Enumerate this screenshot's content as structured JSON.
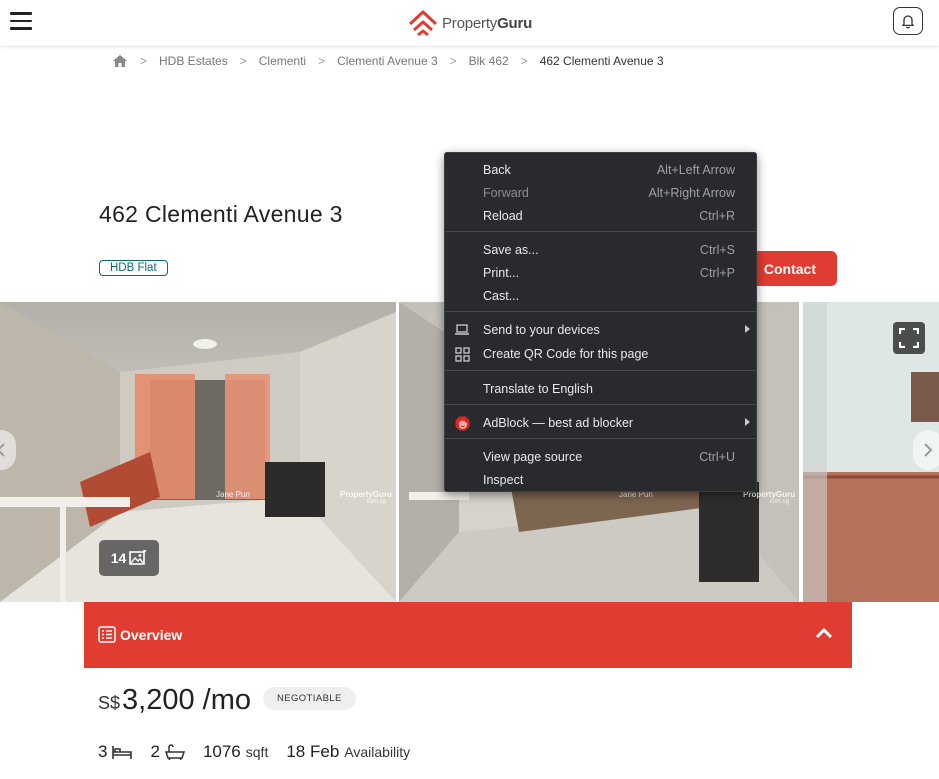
{
  "header": {
    "brand_light": "Property",
    "brand_bold": "Guru",
    "brand_color": "#e03c31"
  },
  "breadcrumb": {
    "items": [
      "HDB Estates",
      "Clementi",
      "Clementi Avenue 3",
      "Blk 462"
    ],
    "current": "462 Clementi Avenue 3",
    "separator": ">"
  },
  "listing": {
    "title": "462 Clementi Avenue 3",
    "type_badge": "HDB Flat",
    "contact_label": "Contact",
    "photo_count": "14",
    "watermark_name": "Jane Pun",
    "watermark_brand": "PropertyGuru",
    "watermark_domain": ".com.sg"
  },
  "overview": {
    "label": "Overview"
  },
  "price": {
    "currency": "S$",
    "amount": "3,200 /mo",
    "negotiable": "NEGOTIABLE"
  },
  "facts": {
    "bedrooms": "3",
    "bathrooms": "2",
    "area": "1076",
    "area_unit": "sqft",
    "availability_date": "18 Feb",
    "availability_label": "Availability"
  },
  "context_menu": {
    "back": {
      "label": "Back",
      "shortcut": "Alt+Left Arrow"
    },
    "forward": {
      "label": "Forward",
      "shortcut": "Alt+Right Arrow"
    },
    "reload": {
      "label": "Reload",
      "shortcut": "Ctrl+R"
    },
    "save_as": {
      "label": "Save as...",
      "shortcut": "Ctrl+S"
    },
    "print": {
      "label": "Print...",
      "shortcut": "Ctrl+P"
    },
    "cast": {
      "label": "Cast..."
    },
    "send_devices": {
      "label": "Send to your devices"
    },
    "qr_code": {
      "label": "Create QR Code for this page"
    },
    "translate": {
      "label": "Translate to English"
    },
    "adblock": {
      "label": "AdBlock — best ad blocker"
    },
    "view_source": {
      "label": "View page source",
      "shortcut": "Ctrl+U"
    },
    "inspect": {
      "label": "Inspect"
    }
  },
  "colors": {
    "accent": "#e03c31",
    "badge_teal": "#0d6b68",
    "menu_bg": "#292a2d"
  },
  "icons": [
    "hamburger-icon",
    "bell-icon",
    "home-icon",
    "image-icon",
    "fullscreen-icon",
    "list-icon",
    "chevron-up-icon",
    "bed-icon",
    "bath-icon",
    "laptop-icon",
    "qr-icon",
    "adblock-icon"
  ]
}
